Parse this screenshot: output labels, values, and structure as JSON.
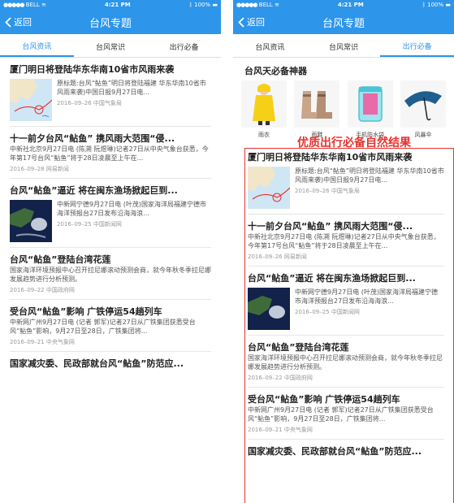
{
  "status": {
    "carrier": "BELL",
    "time": "4:21 PM",
    "battery": "100%"
  },
  "nav": {
    "back": "返回",
    "title": "台风专题"
  },
  "tabs": [
    "台风资讯",
    "台风常识",
    "出行必备"
  ],
  "overlay_text": "优质出行必备自然结果",
  "left_items": [
    {
      "title": "厦门明日将登陆华东华南10省市风雨来袭",
      "summary": "原标题:台风“鲇鱼”明日将登陆福建 华东华南10省市风雨来袭)中国日报9月27日电...",
      "meta": "2016–09–26 中国气象局",
      "thumb": "map"
    },
    {
      "title": "十一前夕台风“鲇鱼” 携风雨大范围“侵...",
      "summary": "中新社北京9月27日电 (陈溯 阮煜琳)记者27日从中央气象台获悉，今年第17号台风“鲇鱼”将于28日凌晨至上午在...",
      "meta": "2016–09–28 网易新闻",
      "thumb": ""
    },
    {
      "title": "台风“鲇鱼”逼近 将在闽东渔场掀起巨到...",
      "summary": "中新网宁德9月27日电 (叶茂)国家海洋局福建宁德市海洋预报台27日发布沿海海浪...",
      "meta": "2016–09–25 中国新闻网",
      "thumb": "sat"
    },
    {
      "title": "台风“鲇鱼”登陆台湾花莲",
      "summary": "国家海洋环境预报中心召开拉尼娜滚动预测会商，就今年秋冬季拉尼娜发展趋势进行分析预测。",
      "meta": "2016–09–22 中国政府网",
      "thumb": ""
    },
    {
      "title": "受台风“鲇鱼”影响 广铁停运54趟列车",
      "summary": "中新网广州9月27日电 (记者 郭军)记者27日从广铁集团获悉受台风“鲇鱼”影响，9月27日至28日，广铁集团将...",
      "meta": "2016–09–21 中央气象网",
      "thumb": ""
    },
    {
      "title": "国家减灾委、民政部就台风“鲇鱼”防范应...",
      "summary": "",
      "meta": "",
      "thumb": ""
    }
  ],
  "right_section": {
    "title": "台风天必备神器",
    "products": [
      {
        "label": "雨衣",
        "icon": "raincoat-icon"
      },
      {
        "label": "雨鞋",
        "icon": "rain-boots-icon"
      },
      {
        "label": "手机防水袋",
        "icon": "waterproof-phone-bag-icon"
      },
      {
        "label": "风暴伞",
        "icon": "storm-umbrella-icon"
      }
    ]
  },
  "right_items": [
    {
      "title": "厦门明日将登陆华东华南10省市风雨来袭",
      "summary": "原标题:台风“鲇鱼”明日将登陆福建 华东华南10省市风雨来袭)中国日报9月27日电...",
      "meta": "2016–09–26 中国气象局",
      "thumb": "map"
    },
    {
      "title": "十一前夕台风“鲇鱼” 携风雨大范围“侵...",
      "summary": "中新社北京9月27日电 (陈溯 阮煜琳)记者27日从中央气象台获悉，今年第17号台风“鲇鱼”将于28日凌晨至上午在...",
      "meta": "2016–09–26 网易新闻",
      "thumb": ""
    },
    {
      "title": "台风“鲇鱼”逼近 将在闽东渔场掀起巨到...",
      "summary": "中新网宁德9月27日电 (叶茂)国家海洋局福建宁德市海洋预报台27日发布沿海海浪...",
      "meta": "2016–09–25 中国新闻网",
      "thumb": "sat"
    },
    {
      "title": "台风“鲇鱼”登陆台湾花莲",
      "summary": "国家海洋环境预报中心召开拉尼娜滚动预测会商，就今年秋冬季拉尼娜发展趋势进行分析预测。",
      "meta": "2016–09–22 中国政府网",
      "thumb": ""
    },
    {
      "title": "受台风“鲇鱼”影响 广铁停运54趟列车",
      "summary": "中新网广州9月27日电 (记者 郭军)记者27日从广铁集团获悉受台风“鲇鱼”影响，9月27日至28日，广铁集团将...",
      "meta": "2016–09–21 中央气象网",
      "thumb": ""
    },
    {
      "title": "国家减灾委、民政部就台风“鲇鱼”防范应...",
      "summary": "",
      "meta": "",
      "thumb": ""
    }
  ],
  "colors": {
    "accent": "#2d95ea",
    "highlight": "#e8322d"
  }
}
